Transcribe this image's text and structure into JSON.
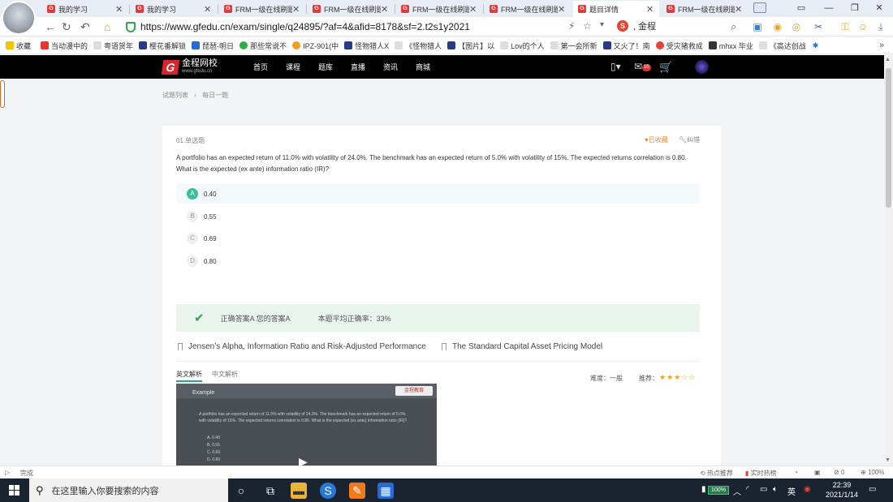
{
  "browser": {
    "tabs": [
      {
        "label": "我的学习",
        "active": false
      },
      {
        "label": "我的学习",
        "active": false
      },
      {
        "label": "FRM一级在线刷题",
        "active": false
      },
      {
        "label": "FRM一级在线刷题",
        "active": false
      },
      {
        "label": "FRM一级在线刷题",
        "active": false
      },
      {
        "label": "FRM一级在线刷题",
        "active": false
      },
      {
        "label": "题目详情",
        "active": true
      },
      {
        "label": "FRM一级在线刷题",
        "active": false
      }
    ],
    "url": "https://www.gfedu.cn/exam/single/q24895/?af=4&afid=8178&sf=2.t2s1y2021",
    "search_text": ", 金程",
    "bookmarks": [
      "收藏",
      "当动漫中的",
      "粤语贺年",
      "樱花番解锁",
      "琵琶-明日",
      "那些常说不",
      "IPZ-901(中",
      "怪物猎人X",
      "《怪物猎人",
      "【图片】以",
      "Lov的个人",
      "第一会所新",
      "又火了！南",
      "受灾猪救成",
      "mhxx 毕业",
      "《高达创战"
    ]
  },
  "site": {
    "logo_title": "金程网校",
    "logo_sub": "www.gfedu.cn",
    "nav": [
      "首页",
      "课程",
      "题库",
      "直播",
      "资讯",
      "商城"
    ],
    "message_badge": "10",
    "breadcrumb": [
      "试题列表",
      "›",
      "每日一题"
    ]
  },
  "question": {
    "type": "01.单选题",
    "favorited": "已收藏",
    "correct_err": "纠错",
    "text": "A portfolio has an expected return of 11.0% with volatility of 24.0%. The benchmark has an expected return of 5.0% with volatility of 15%. The expected returns correlation is 0.80. What is the expected (ex ante) information ratio (IR)?",
    "options": [
      {
        "letter": "A",
        "value": "0.40",
        "selected": true
      },
      {
        "letter": "B",
        "value": "0.55",
        "selected": false
      },
      {
        "letter": "C",
        "value": "0.69",
        "selected": false
      },
      {
        "letter": "D",
        "value": "0.80",
        "selected": false
      }
    ],
    "result_answer": "正确答案A 您的答案A",
    "result_rate": "本题平均正确率：33%",
    "knowledge_points": [
      "Jensen’s Alpha, Information Ratio and Risk-Adjusted Performance",
      "The Standard Capital Asset Pricing Model"
    ],
    "analysis_tabs": [
      "英文解析",
      "中文解析"
    ],
    "difficulty": "难度：一般",
    "recommend_label": "推荐：",
    "recommend_stars": 3,
    "recommend_max": 5
  },
  "video": {
    "title": "Example",
    "logo": "金程教育",
    "text": "A portfolio has an expected return of 11.0% with volatility of 24.0%. The benchmark has an expected return of 5.0% with volatility of 15%. The expected returns correlation is 0.80. What is the expected (ex ante) information ratio (IR)?",
    "options": [
      "A. 0.40",
      "B. 0.55",
      "C. 0.69",
      "D. 0.80"
    ]
  },
  "status": {
    "left": "完成",
    "right": [
      "热点推荐",
      "实时热榜",
      "0",
      "100%"
    ]
  },
  "taskbar": {
    "search_placeholder": "在这里输入你要搜索的内容",
    "battery": "100%",
    "ime": "英",
    "time": "22:39",
    "date": "2021/1/14"
  }
}
